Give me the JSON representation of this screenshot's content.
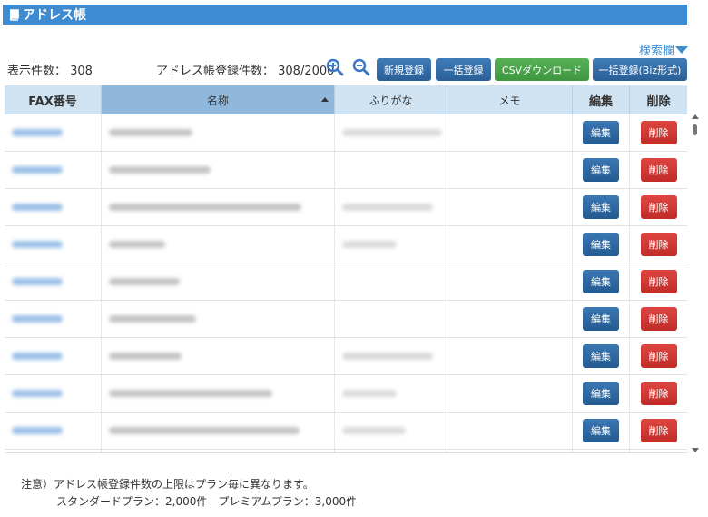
{
  "header": {
    "title": "アドレス帳",
    "icon": "book-icon"
  },
  "search_link": "検索欄",
  "display_count": "表示件数： 308",
  "registered_count": "アドレス帳登録件数： 308/2000",
  "toolbar": {
    "new_label": "新規登録",
    "bulk_label": "一括登録",
    "csv_label": "CSVダウンロード",
    "bulk_biz_label": "一括登録(Biz形式)"
  },
  "table": {
    "columns": [
      "FAX番号",
      "名称",
      "ふりがな",
      "メモ",
      "編集",
      "削除"
    ],
    "sorted_column": "名称",
    "edit_label": "編集",
    "delete_label": "削除"
  },
  "note": {
    "line1": "注意）アドレス帳登録件数の上限はプラン毎に異なります。",
    "line2": "スタンダードプラン：2,000件　プレミアムプラン：3,000件"
  },
  "colors": {
    "header": "#3d8bd0",
    "button_blue": "#2a5f96",
    "button_green": "#3f963f",
    "button_red": "#c12c28"
  }
}
